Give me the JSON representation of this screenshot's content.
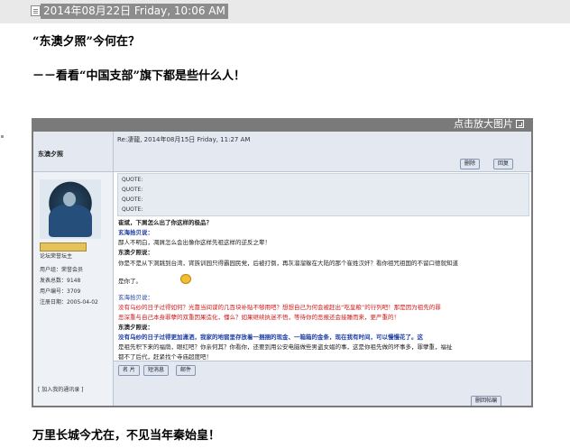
{
  "header": {
    "datetime": "2014年08月22日 Friday, 10:06 AM"
  },
  "post": {
    "line1": "“东澳夕照”今何在？",
    "line2": "－－看看“中国支部”旗下都是些什么人！",
    "line3": "万里长城今尤在，不见当年秦始皇！"
  },
  "screenshot": {
    "caption": "点击放大图片",
    "author": "东澳夕照",
    "post_info": "Re:凄龍, 2014年08月15日 Friday, 11:27 AM",
    "edit_button": "删除",
    "reply_button": "回复",
    "rank": "论坛荣誉坛主",
    "stats": [
      "用户组：荣誉会员",
      "发表总数：9148",
      "用户编号：3709",
      "注册日期：2005-04-02"
    ],
    "quotes": [
      "QUOTE:",
      "QUOTE:",
      "QUOTE:",
      "QUOTE:"
    ],
    "lines": [
      "崔斌，下屑怎么出了你这样的极品？",
      "玄海拾贝说：",
      "鄙人不明白，凋屑怎么会出像你这样先祖这样的逆反之辈！",
      "东澳夕照说：",
      "你是不是从下洞跳到台湾，宵族训园只得霸园民党，后被打倒，再灰溜溜躲在大陆的那个崔姓汉奸？看你祖咒祖国的不留口德就知道",
      "是你了。",
      "玄海拾贝说：",
      "没有乌纱的日子过得如何？光靠当间谍的几百块补贴不够用吧？想想自己为何会被赶出“吃皇粮”的行列吧！那是因为祖先的罪",
      "恶深重与自己本身罪孽的双重因果造化，懂么？如果继续执迷不悟，等待你的恶报还会接踵而来，更严重的！",
      "东澳夕照说：",
      "没有乌纱的日子过得更加潇洒，我家的地窖里存放着一捆捆的现金、一箱箱的金条，现在我有时间，可以慢慢花了。这",
      "是祖先积下来的福荫，眼红吧？你亲何其？你看你，还要到用公安电脑做些男盗女娼的事，这是你祖先做的坏事多，罪孽重，福祉",
      "都不了后代，赶紧找个寺庙超度吧！"
    ],
    "profile_button": "名 片",
    "pm_button": "短消息",
    "mail_button": "邮件",
    "join_link": "[ 加入我的通讯录 ]",
    "delete_button": "删回帖编"
  }
}
